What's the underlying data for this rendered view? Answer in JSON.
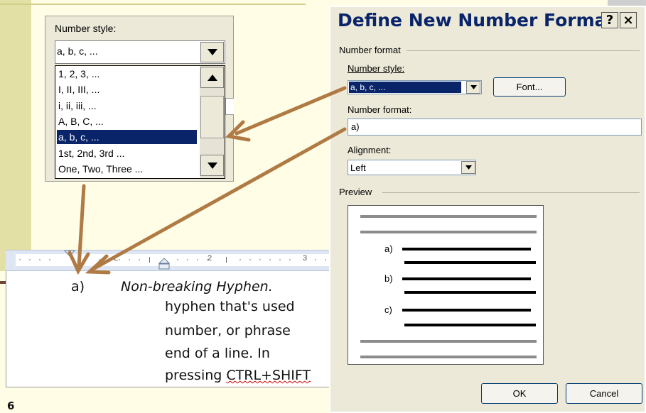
{
  "slide": {
    "number": "6"
  },
  "number_style_panel": {
    "label": "Number style:",
    "selected_value": "a, b, c, ...",
    "options": [
      "1, 2, 3, ...",
      "I, II, III, ...",
      "i, ii, iii, ...",
      "A, B, C, ...",
      "a, b, c, ...",
      "1st, 2nd, 3rd ...",
      "One, Two, Three ..."
    ],
    "selected_index": 4
  },
  "ruler": {
    "marks": [
      "L",
      "2",
      "3"
    ]
  },
  "document": {
    "list_marker": "a)",
    "heading": "Non-breaking Hyphen.",
    "lines": [
      "hyphen that's used",
      "number, or phrase",
      "end of a line. In",
      "pressing "
    ],
    "shortcut": "CTRL+SHIFT"
  },
  "dialog": {
    "title": "Define New Number Format",
    "help_button": "?",
    "close_button": "×",
    "number_format_group": "Number format",
    "number_style_label": "Number style:",
    "number_style_value": "a, b, c, ...",
    "font_button": "Font...",
    "number_format_label": "Number format:",
    "number_format_value": "a)",
    "alignment_label": "Alignment:",
    "alignment_value": "Left",
    "preview_group": "Preview",
    "preview_markers": [
      "a)",
      "b)",
      "c)"
    ],
    "ok_button": "OK",
    "cancel_button": "Cancel"
  },
  "colors": {
    "highlight": "#0a246a",
    "arrow": "#b07a44",
    "sidebar": "#e3e0a6"
  }
}
